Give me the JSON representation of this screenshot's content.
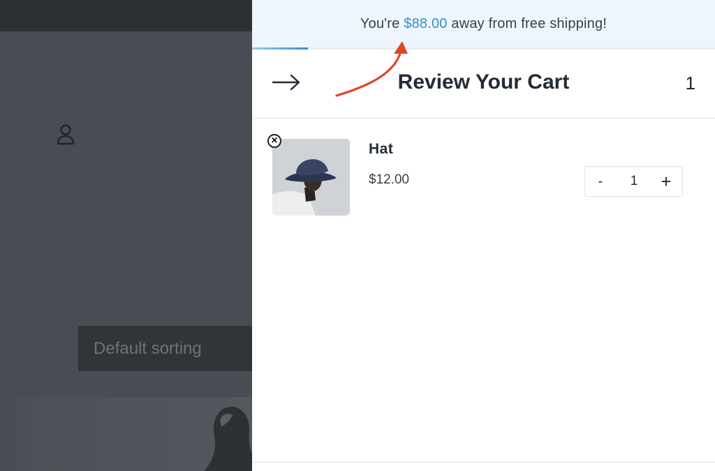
{
  "background": {
    "sorting_label": "Default sorting"
  },
  "shipping": {
    "prefix": "You're",
    "amount": "$88.00",
    "suffix": "away from free shipping!",
    "progress_fraction": 0.12
  },
  "cart": {
    "title": "Review Your Cart",
    "count": "1",
    "close_icon": "arrow-right-icon",
    "items": [
      {
        "name": "Hat",
        "price": "$12.00",
        "quantity": "1",
        "minus_label": "-",
        "plus_label": "+",
        "remove_icon": "close-icon"
      }
    ]
  },
  "colors": {
    "accent": "#3a8fc4",
    "shipping_bg": "#eef5fc",
    "annotation_arrow": "#e0452b",
    "overlay": "#474d52"
  }
}
